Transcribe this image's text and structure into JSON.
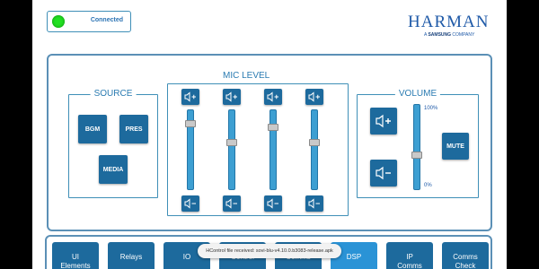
{
  "status": {
    "text": "Connected",
    "color": "#22e022"
  },
  "logo": {
    "name": "HARMAN",
    "sub_prefix": "A ",
    "sub_brand": "SAMSUNG",
    "sub_suffix": " COMPANY"
  },
  "source": {
    "title": "SOURCE",
    "buttons": [
      "BGM",
      "PRES",
      "MEDIA"
    ]
  },
  "mic_level": {
    "title": "MIC LEVEL",
    "channels": [
      {
        "level": 0.85
      },
      {
        "level": 0.6
      },
      {
        "level": 0.8
      },
      {
        "level": 0.6
      }
    ]
  },
  "volume": {
    "title": "VOLUME",
    "max_label": "100%",
    "min_label": "0%",
    "mute_label": "MUTE",
    "level": 0.4
  },
  "nav": {
    "items": [
      {
        "label": "UI\nElements",
        "active": false
      },
      {
        "label": "Relays",
        "active": false
      },
      {
        "label": "IO",
        "active": false
      },
      {
        "label": "Control",
        "active": false
      },
      {
        "label": "Comms",
        "active": false
      },
      {
        "label": "DSP",
        "active": true
      },
      {
        "label": "IP\nComms",
        "active": false
      },
      {
        "label": "Comms\nCheck",
        "active": false
      }
    ]
  },
  "toast": {
    "text": "HControl file received: sovi-blu-v4.10.0.b3083-release.apk"
  },
  "colors": {
    "accent": "#1d6a9d",
    "active": "#2a93d6",
    "border": "#5b90b6"
  }
}
